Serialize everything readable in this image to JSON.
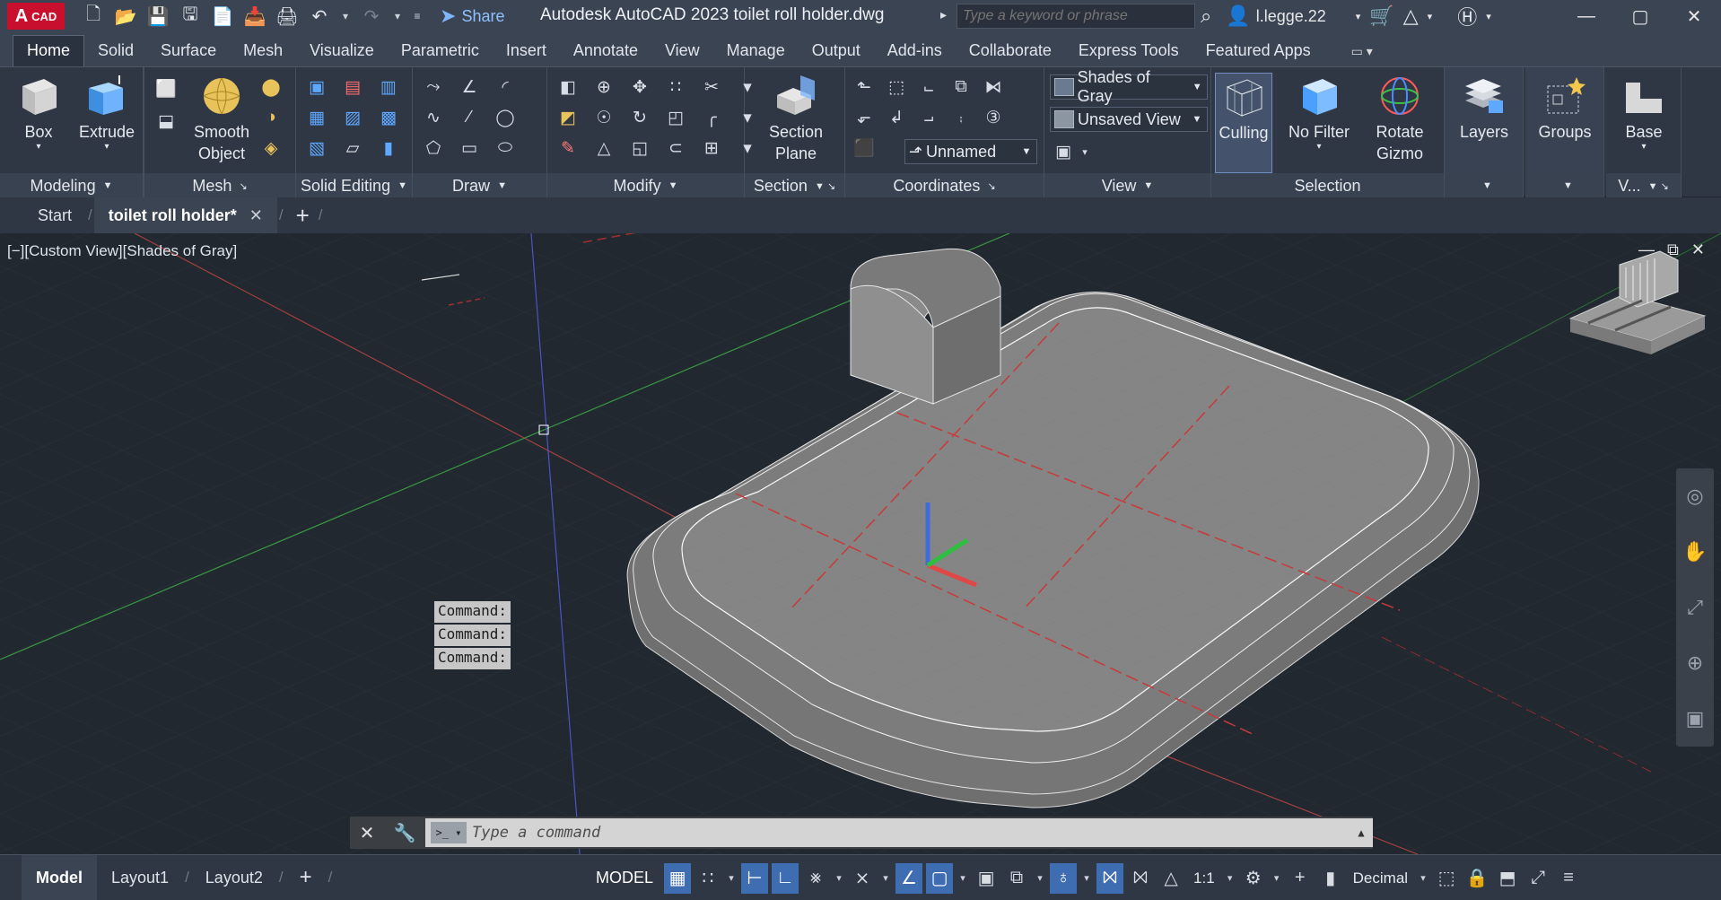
{
  "app": {
    "logo_letter": "A",
    "logo_text": "CAD",
    "title": "Autodesk AutoCAD 2023    toilet roll holder.dwg",
    "share_label": "Share",
    "search_placeholder": "Type a keyword or phrase",
    "user_name": "l.legge.22"
  },
  "ribbon_tabs": [
    "Home",
    "Solid",
    "Surface",
    "Mesh",
    "Visualize",
    "Parametric",
    "Insert",
    "Annotate",
    "View",
    "Manage",
    "Output",
    "Add-ins",
    "Collaborate",
    "Express Tools",
    "Featured Apps"
  ],
  "ribbon": {
    "modeling": {
      "title": "Modeling",
      "box": "Box",
      "extrude": "Extrude"
    },
    "mesh": {
      "title": "Mesh",
      "smooth_1": "Smooth",
      "smooth_2": "Object"
    },
    "solid_editing": {
      "title": "Solid Editing"
    },
    "draw": {
      "title": "Draw"
    },
    "modify": {
      "title": "Modify"
    },
    "section": {
      "title": "Section",
      "plane_1": "Section",
      "plane_2": "Plane"
    },
    "coordinates": {
      "title": "Coordinates",
      "ucs_name": "Unnamed"
    },
    "view": {
      "title": "View",
      "visual_style": "Shades of Gray",
      "named_view": "Unsaved View"
    },
    "selection": {
      "title": "Selection",
      "culling": "Culling",
      "no_filter": "No Filter",
      "gizmo_1": "Rotate",
      "gizmo_2": "Gizmo"
    },
    "layers": {
      "label": "Layers"
    },
    "groups": {
      "label": "Groups"
    },
    "base": {
      "label": "Base",
      "title": "V..."
    }
  },
  "doc_tabs": {
    "start": "Start",
    "active": "toilet roll holder*"
  },
  "viewport": {
    "label": "[−][Custom View][Shades of Gray]",
    "command_history": [
      "Command:",
      "Command:",
      "Command:"
    ],
    "command_placeholder": "Type a command"
  },
  "status": {
    "layout_tabs": [
      "Model",
      "Layout1",
      "Layout2"
    ],
    "model_space": "MODEL",
    "scale": "1:1",
    "units": "Decimal"
  },
  "colors": {
    "ribbon_bg": "#2f3744",
    "viewport_bg": "#212830",
    "accent": "#3f6db2",
    "x_axis": "#d24848",
    "y_axis": "#3fbf4a",
    "z_axis": "#4a60e0"
  }
}
